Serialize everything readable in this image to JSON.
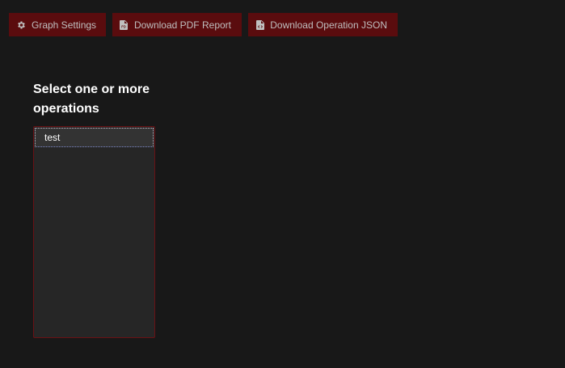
{
  "toolbar": {
    "buttons": [
      {
        "label": "Graph Settings",
        "icon": "gear-icon"
      },
      {
        "label": "Download PDF Report",
        "icon": "pdf-file-icon"
      },
      {
        "label": "Download Operation JSON",
        "icon": "code-file-icon"
      }
    ]
  },
  "operations": {
    "title": "Select one or more operations",
    "options": [
      "test"
    ]
  },
  "colors": {
    "background": "#181818",
    "button_bg": "#5a0c0e",
    "button_text": "#bfbfbf",
    "listbox_bg": "#262626",
    "listbox_border": "#6a1014"
  }
}
